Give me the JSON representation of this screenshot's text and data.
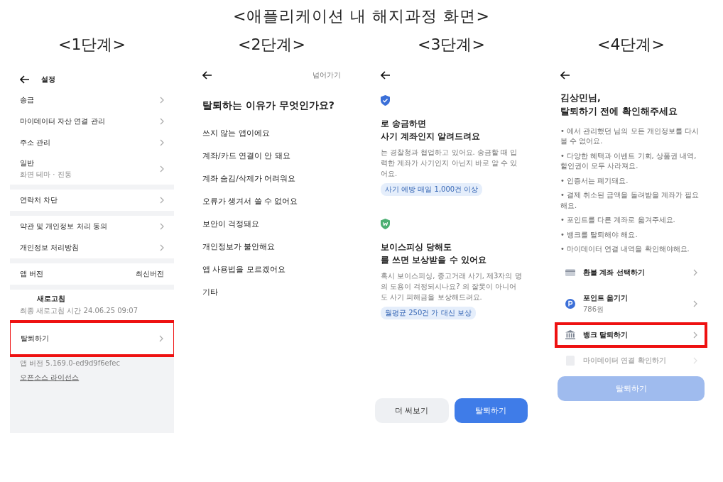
{
  "title": "<애플리케이션 내 해지과정 화면>",
  "steps": [
    {
      "label": "<1단계>",
      "kind": "settings",
      "header": {
        "title": "설정"
      },
      "groups": [
        [
          {
            "label": "송금",
            "kind": "nav"
          },
          {
            "label": "마이데이터 자산 연결 관리",
            "kind": "nav"
          },
          {
            "label": "주소 관리",
            "kind": "nav"
          },
          {
            "label": "일반",
            "subtitle": "화면 테마 · 진동",
            "kind": "nav"
          }
        ],
        [
          {
            "label": "연락처 차단",
            "kind": "nav"
          }
        ],
        [
          {
            "label": "약관 및 개인정보 처리 동의",
            "kind": "nav"
          },
          {
            "label": "개인정보 처리방침",
            "kind": "nav"
          }
        ],
        [
          {
            "label": "앱 버전",
            "value": "최신버전",
            "kind": "value"
          }
        ]
      ],
      "refresh": {
        "title": "새로고침",
        "subtitle": "최종 새로고침 시간 24.06.25 09:07"
      },
      "withdraw": {
        "label": "탈퇴하기",
        "highlighted": true
      },
      "footer": {
        "version": "앱 버전 5.169.0-ed9d9f6efec",
        "link": "오픈소스 라이선스"
      }
    },
    {
      "label": "<2단계>",
      "kind": "reasons",
      "skip": "넘어가기",
      "question": "탈퇴하는 이유가 무엇인가요?",
      "reasons": [
        "쓰지 않는 앱이에요",
        "계좌/카드 연결이 안 돼요",
        "계좌 숨김/삭제가 어려워요",
        "오류가 생겨서 쓸 수 없어요",
        "보안이 걱정돼요",
        "개인정보가 불안해요",
        "앱 사용법을 모르겠어요",
        "기타"
      ]
    },
    {
      "label": "<3단계>",
      "kind": "benefits",
      "benefits": [
        {
          "kind": "shield-check",
          "title": [
            "로 송금하면",
            "사기 계좌인지 알려드려요"
          ],
          "body": "는 경찰청과 협업하고 있어요. 송금할 때 입력한 계좌가 사기인지 아닌지 바로 알 수 있어요.",
          "tag": "사기 예방 매일 1,000건 이상"
        },
        {
          "kind": "shield-won",
          "title": [
            "보이스피싱 당해도",
            "를 쓰면 보상받을 수 있어요"
          ],
          "body": "혹시 보이스피싱, 중고거래 사기, 제3자의 명의 도용이 걱정되시나요? 의 잘못이 아니어도 사기 피해금을 보상해드려요.",
          "tag": "월평균 250건 가 대신 보상"
        }
      ],
      "buttons": [
        {
          "label": "더 써보기",
          "kind": "secondary"
        },
        {
          "label": "탈퇴하기",
          "kind": "primary"
        }
      ]
    },
    {
      "label": "<4단계>",
      "kind": "checklist",
      "greeting": [
        "김상민님,",
        "탈퇴하기 전에 확인해주세요"
      ],
      "notes": [
        "• 에서 관리했던 님의 모든 개인정보를 다시 볼 수 없어요.",
        "• 다양한 혜택과 이벤트 기회, 상품권 내역, 할인권이 모두 사라져요.",
        "• 인증서는 폐기돼요.",
        "• 결제 취소된 금액을 돌려받을 계좌가 필요해요.",
        "• 포인트를 다른 계좌로 옮겨주세요.",
        "• 뱅크를 탈퇴해야 해요.",
        "• 마이데이터 연결 내역을 확인해야해요."
      ],
      "actions": [
        {
          "kind": "card",
          "label": "환불 계좌 선택하기",
          "highlighted": false,
          "dimmed": false
        },
        {
          "kind": "point",
          "label": "포인트 옮기기",
          "subtitle": "786원",
          "highlighted": false,
          "dimmed": false
        },
        {
          "kind": "bank",
          "label": "뱅크 탈퇴하기",
          "highlighted": true,
          "dimmed": false
        },
        {
          "kind": "doc",
          "label": "마이데이터 연결 확인하기",
          "highlighted": false,
          "dimmed": true
        }
      ],
      "button": {
        "label": "탈퇴하기",
        "disabled": true
      }
    }
  ]
}
